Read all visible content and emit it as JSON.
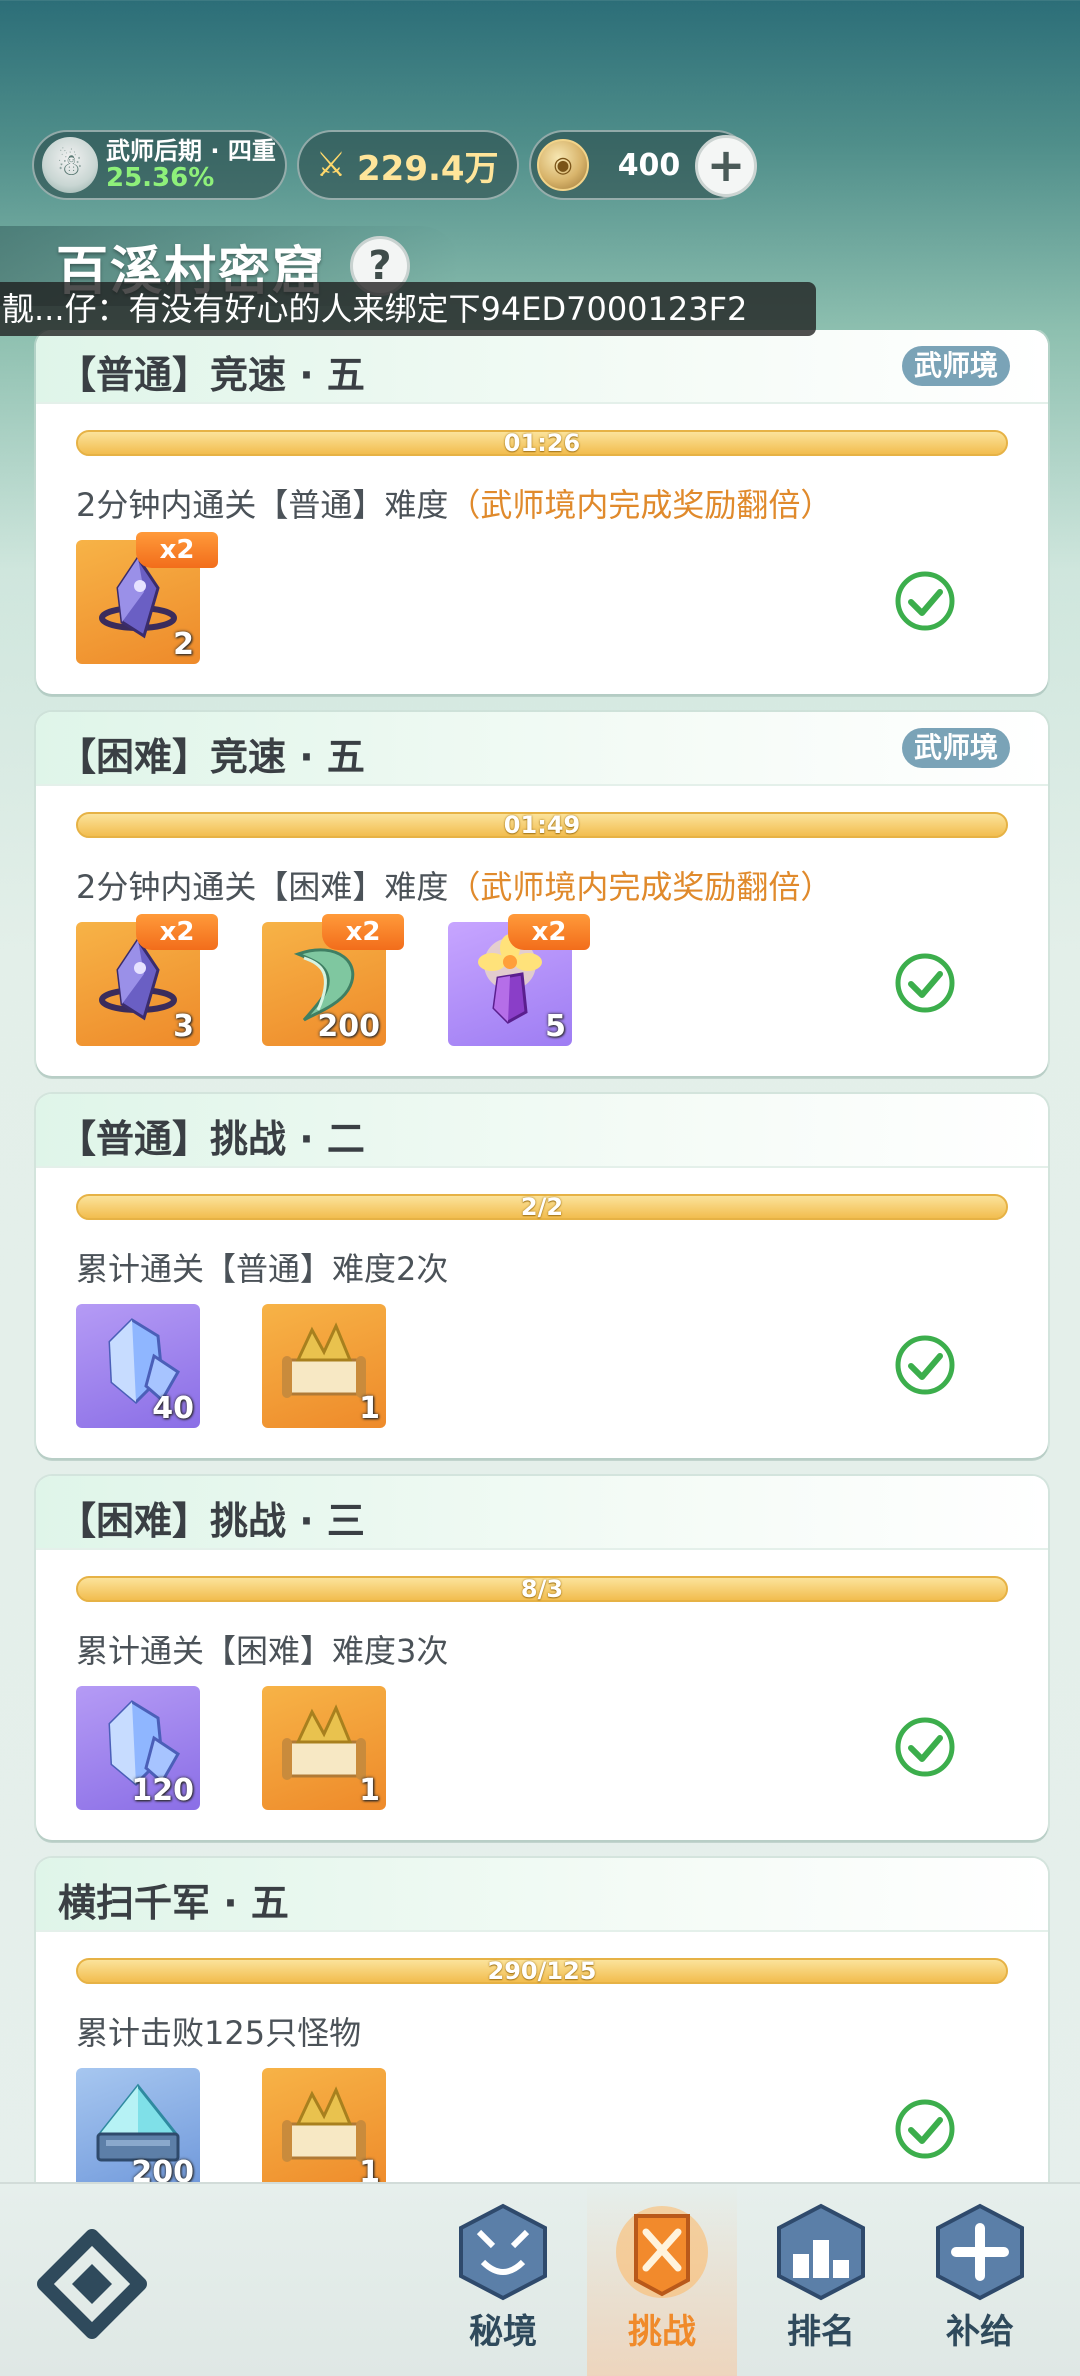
{
  "status": {
    "rank_title": "武师后期 · 四重",
    "rank_progress": "25.36%",
    "power": "229.4万",
    "coins": "400",
    "add_icon": "plus-icon",
    "power_icon": "crossed-swords-icon",
    "coin_icon": "coin-icon"
  },
  "page": {
    "title": "百溪村密窟",
    "help": "?"
  },
  "ticker": {
    "text": "靓...仔：有没有好心的人来绑定下94ED7000123F2"
  },
  "cards": [
    {
      "title": "【普通】竞速 · 五",
      "badge": "武师境",
      "progress_label": "01:26",
      "progress": 1.0,
      "desc_main": "2分钟内通关【普通】难度",
      "desc_bonus": "（武师境内完成奖励翻倍）",
      "rewards": [
        {
          "icon": "dark-crystal-icon",
          "count": "2",
          "bonus": "x2"
        }
      ],
      "status_icon": "check-circle-icon"
    },
    {
      "title": "【困难】竞速 · 五",
      "badge": "武师境",
      "progress_label": "01:49",
      "progress": 1.0,
      "desc_main": "2分钟内通关【困难】难度",
      "desc_bonus": "（武师境内完成奖励翻倍）",
      "rewards": [
        {
          "icon": "dark-crystal-icon",
          "count": "3",
          "bonus": "x2"
        },
        {
          "icon": "green-herb-icon",
          "count": "200",
          "bonus": "x2"
        },
        {
          "icon": "flower-gem-icon",
          "count": "5",
          "bonus": "x2"
        }
      ],
      "status_icon": "check-circle-icon"
    },
    {
      "title": "【普通】挑战 · 二",
      "badge": "",
      "progress_label": "2/2",
      "progress": 1.0,
      "desc_main": "累计通关【普通】难度2次",
      "desc_bonus": "",
      "rewards": [
        {
          "icon": "blue-crystal-icon",
          "count": "40",
          "bonus": ""
        },
        {
          "icon": "scroll-icon",
          "count": "1",
          "bonus": ""
        }
      ],
      "status_icon": "check-circle-icon"
    },
    {
      "title": "【困难】挑战 · 三",
      "badge": "",
      "progress_label": "8/3",
      "progress": 1.0,
      "desc_main": "累计通关【困难】难度3次",
      "desc_bonus": "",
      "rewards": [
        {
          "icon": "blue-crystal-icon",
          "count": "120",
          "bonus": ""
        },
        {
          "icon": "scroll-icon",
          "count": "1",
          "bonus": ""
        }
      ],
      "status_icon": "check-circle-icon"
    },
    {
      "title": "横扫千军 · 五",
      "badge": "",
      "progress_label": "290/125",
      "progress": 1.0,
      "desc_main": "累计击败125只怪物",
      "desc_bonus": "",
      "rewards": [
        {
          "icon": "ice-chest-icon",
          "count": "200",
          "bonus": ""
        },
        {
          "icon": "scroll-icon",
          "count": "1",
          "bonus": ""
        }
      ],
      "status_icon": "check-circle-icon"
    }
  ],
  "nav": {
    "logo_icon": "diamond-logo-icon",
    "items": [
      {
        "label": "秘境",
        "icon": "demon-mask-icon",
        "active": false
      },
      {
        "label": "挑战",
        "icon": "crossed-swords-banner-icon",
        "active": true
      },
      {
        "label": "排名",
        "icon": "podium-icon",
        "active": false
      },
      {
        "label": "补给",
        "icon": "supply-icon",
        "active": false
      }
    ]
  },
  "colors": {
    "accent_orange": "#f08a2a",
    "progress_yellow": "#f5c560",
    "check_green": "#3cae4c",
    "badge_blue": "#7aa3b7"
  }
}
